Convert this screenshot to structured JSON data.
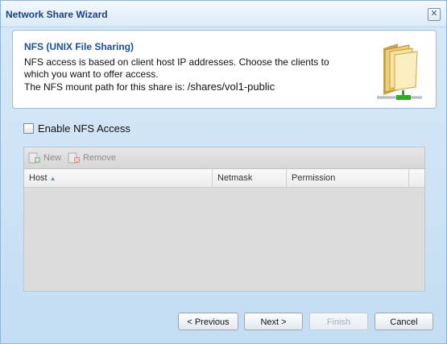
{
  "window": {
    "title": "Network Share Wizard",
    "close_glyph": "✕"
  },
  "info": {
    "heading": "NFS (UNIX File Sharing)",
    "line1": "NFS access is based on client host IP addresses. Choose the clients to which you want to offer access.",
    "mount_prefix": "The NFS mount path for this share is: ",
    "mount_path": "/shares/vol1-public",
    "icon": "folder-network-icon"
  },
  "nfs_checkbox": {
    "label": "Enable NFS Access",
    "checked": false
  },
  "toolbar": {
    "new_label": "New",
    "remove_label": "Remove"
  },
  "grid": {
    "columns": [
      "Host",
      "Netmask",
      "Permission"
    ],
    "sorted_column": "Host",
    "rows": []
  },
  "buttons": {
    "previous": "< Previous",
    "next": "Next >",
    "finish": "Finish",
    "cancel": "Cancel"
  }
}
